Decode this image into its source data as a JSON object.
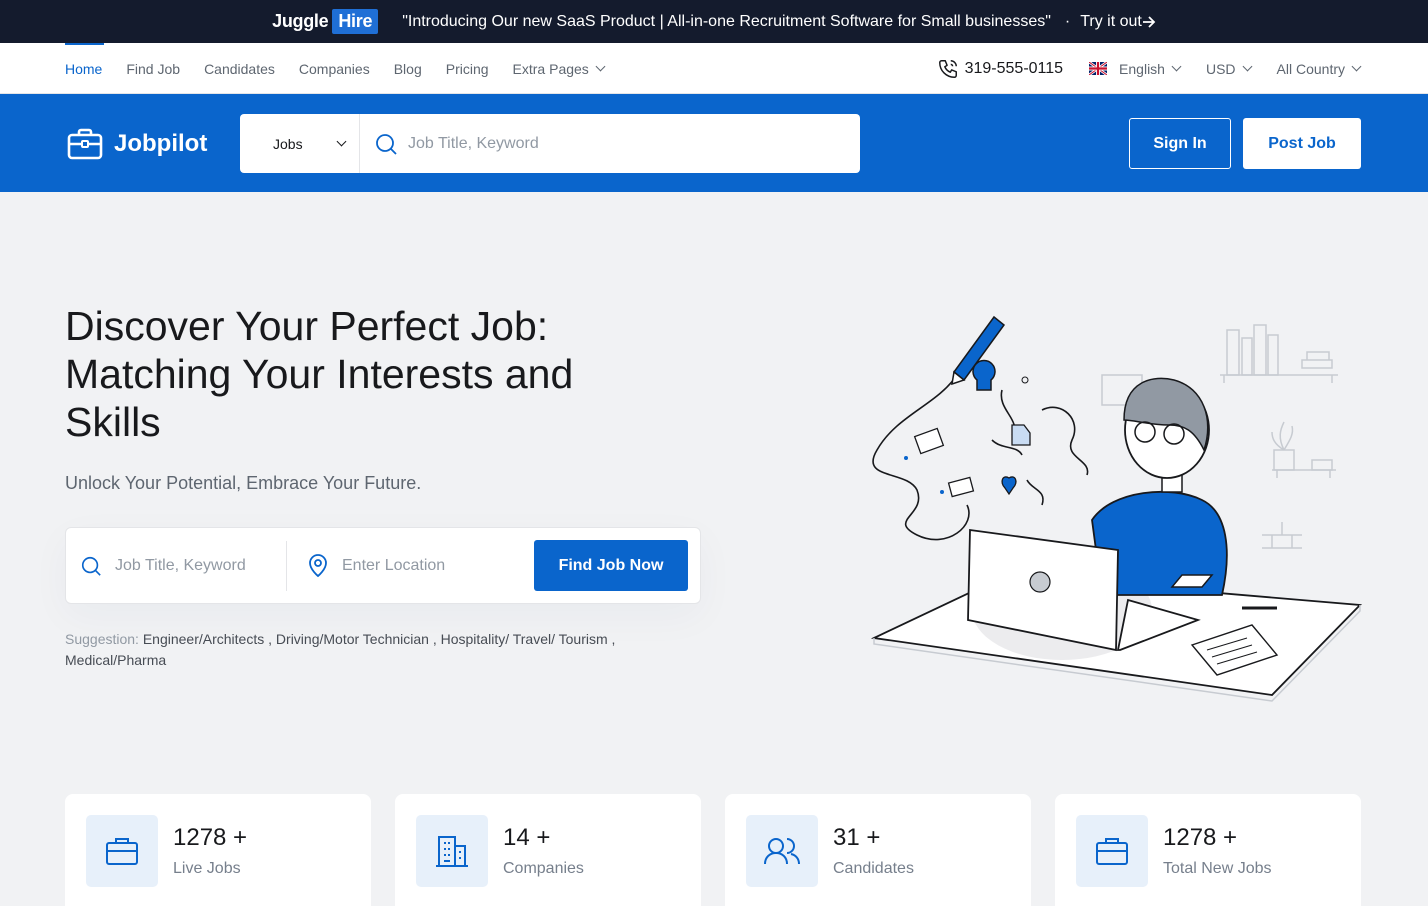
{
  "promo": {
    "brand_juggle": "Juggle",
    "brand_hire": "Hire",
    "message": "\"Introducing Our new SaaS Product | All-in-one Recruitment Software for Small businesses\"",
    "separator": "·",
    "cta": "Try it out"
  },
  "nav": {
    "links": [
      "Home",
      "Find Job",
      "Candidates",
      "Companies",
      "Blog",
      "Pricing",
      "Extra Pages"
    ],
    "phone": "319-555-0115",
    "language": "English",
    "currency": "USD",
    "country": "All Country"
  },
  "header": {
    "logo": "Jobpilot",
    "search_category": "Jobs",
    "search_placeholder": "Job Title, Keyword",
    "sign_in": "Sign In",
    "post_job": "Post Job"
  },
  "hero": {
    "title_lines": [
      "Discover Your Perfect Job:",
      "Matching Your Interests and",
      "Skills"
    ],
    "subtitle": "Unlock Your Potential, Embrace Your Future.",
    "keyword_placeholder": "Job Title, Keyword",
    "location_placeholder": "Enter Location",
    "find_button": "Find Job Now",
    "suggestion_label": "Suggestion:",
    "suggestions": [
      "Engineer/Architects",
      "Driving/Motor Technician",
      "Hospitality/ Travel/ Tourism",
      "Medical/Pharma"
    ]
  },
  "stats": [
    {
      "number": "1278 +",
      "label": "Live Jobs",
      "icon": "briefcase-icon"
    },
    {
      "number": "14 +",
      "label": "Companies",
      "icon": "building-icon"
    },
    {
      "number": "31 +",
      "label": "Candidates",
      "icon": "users-icon"
    },
    {
      "number": "1278 +",
      "label": "Total New Jobs",
      "icon": "briefcase-icon"
    }
  ],
  "colors": {
    "primary": "#0a65cc",
    "promo_bg": "#141b2d",
    "page_bg": "#f1f2f4",
    "icon_bg": "#e7f0fa"
  }
}
